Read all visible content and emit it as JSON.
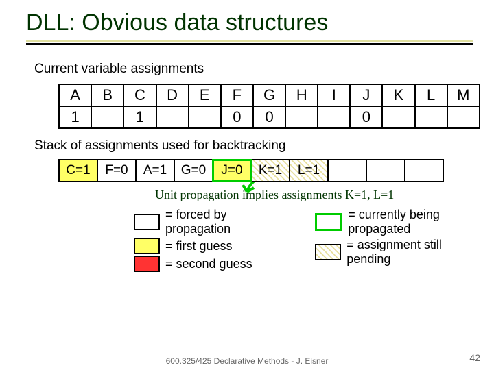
{
  "title": "DLL: Obvious data structures",
  "sec1_label": "Current variable assignments",
  "vars": {
    "headers": [
      "A",
      "B",
      "C",
      "D",
      "E",
      "F",
      "G",
      "H",
      "I",
      "J",
      "K",
      "L",
      "M"
    ],
    "values": [
      "1",
      "",
      "1",
      "",
      "",
      "0",
      "0",
      "",
      "",
      "0",
      "",
      "",
      ""
    ]
  },
  "sec2_label": "Stack of assignments used for backtracking",
  "stack": [
    {
      "label": "C=1",
      "cls": "bg-yellow"
    },
    {
      "label": "F=0",
      "cls": "bg-white"
    },
    {
      "label": "A=1",
      "cls": "bg-white"
    },
    {
      "label": "G=0",
      "cls": "bg-white"
    },
    {
      "label": "J=0",
      "cls": "bg-yellow bg-outline-green"
    },
    {
      "label": "K=1",
      "cls": "bg-hatch"
    },
    {
      "label": "L=1",
      "cls": "bg-hatch"
    },
    {
      "label": "",
      "cls": ""
    },
    {
      "label": "",
      "cls": ""
    },
    {
      "label": "",
      "cls": ""
    }
  ],
  "annot": "Unit propagation implies assignments K=1, L=1",
  "legend": {
    "left": [
      "= forced by propagation",
      "= first guess",
      "= second guess"
    ],
    "right": [
      "= currently being propagated",
      "= assignment still pending"
    ]
  },
  "footer": "600.325/425 Declarative Methods - J. Eisner",
  "pagenum": "42"
}
